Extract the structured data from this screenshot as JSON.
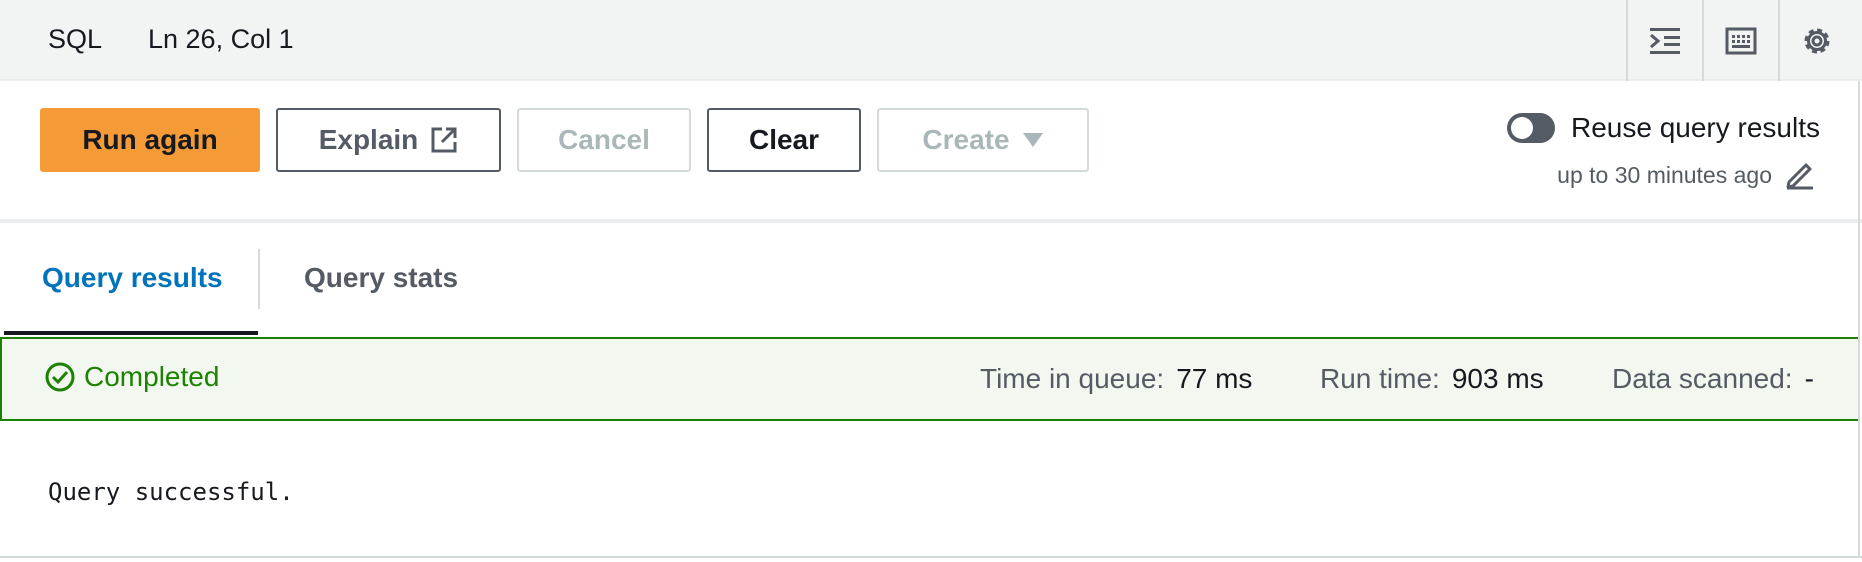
{
  "statusbar": {
    "language": "SQL",
    "cursor_position": "Ln 26, Col 1",
    "icons": [
      "indent-icon",
      "keyboard-icon",
      "gear-icon"
    ]
  },
  "toolbar": {
    "run_again_label": "Run again",
    "explain_label": "Explain",
    "cancel_label": "Cancel",
    "clear_label": "Clear",
    "create_label": "Create",
    "reuse_label": "Reuse query results",
    "reuse_enabled": false,
    "reuse_sub": "up to 30 minutes ago"
  },
  "tabs": [
    {
      "label": "Query results",
      "active": true
    },
    {
      "label": "Query stats",
      "active": false
    }
  ],
  "status": {
    "state": "Completed",
    "time_in_queue_label": "Time in queue:",
    "time_in_queue_value": "77 ms",
    "run_time_label": "Run time:",
    "run_time_value": "903 ms",
    "data_scanned_label": "Data scanned:",
    "data_scanned_value": "-"
  },
  "result_message": "Query successful.",
  "colors": {
    "primary": "#f49b37",
    "success": "#1d8102",
    "link": "#0073bb"
  }
}
